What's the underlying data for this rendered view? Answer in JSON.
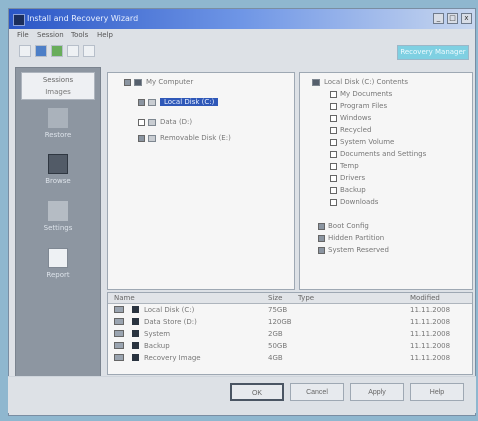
{
  "window": {
    "title": "Install and Recovery Wizard",
    "close_label": "x"
  },
  "menu": [
    "File",
    "Session",
    "Tools",
    "Help"
  ],
  "toolbar": {
    "field_text": "Recovery Manager"
  },
  "sidebar": {
    "header_title": "Sessions",
    "header_sub": "Images",
    "items": [
      {
        "label": "Restore"
      },
      {
        "label": "Browse"
      },
      {
        "label": "Settings"
      },
      {
        "label": "Report"
      }
    ]
  },
  "tree_left": {
    "root": "My Computer",
    "items": [
      {
        "label": "Local Disk (C:)",
        "selected": true
      },
      {
        "label": "Data (D:)"
      },
      {
        "label": "Removable Disk (E:)"
      }
    ]
  },
  "tree_right": {
    "root": "Local Disk (C:) Contents",
    "items": [
      {
        "label": "My Documents"
      },
      {
        "label": "Program Files"
      },
      {
        "label": "Windows"
      },
      {
        "label": "Recycled"
      },
      {
        "label": "System Volume"
      },
      {
        "label": "Documents and Settings"
      },
      {
        "label": "Temp"
      },
      {
        "label": "Drivers"
      },
      {
        "label": "Backup"
      },
      {
        "label": "Downloads"
      },
      {
        "label": "Boot Config"
      },
      {
        "label": "Hidden Partition"
      },
      {
        "label": "System Reserved"
      }
    ]
  },
  "details": {
    "columns": [
      "Name",
      "Size",
      "Type",
      "Modified"
    ],
    "rows": [
      {
        "name": "Local Disk (C:)",
        "size": "75GB",
        "date": "11.11.2008"
      },
      {
        "name": "Data Store (D:)",
        "size": "120GB",
        "date": "11.11.2008"
      },
      {
        "name": "System",
        "size": "2GB",
        "date": "11.11.2008"
      },
      {
        "name": "Backup",
        "size": "50GB",
        "date": "11.11.2008"
      },
      {
        "name": "Recovery Image",
        "size": "4GB",
        "date": "11.11.2008"
      }
    ]
  },
  "buttons": {
    "ok": "OK",
    "cancel": "Cancel",
    "apply": "Apply",
    "help": "Help"
  }
}
